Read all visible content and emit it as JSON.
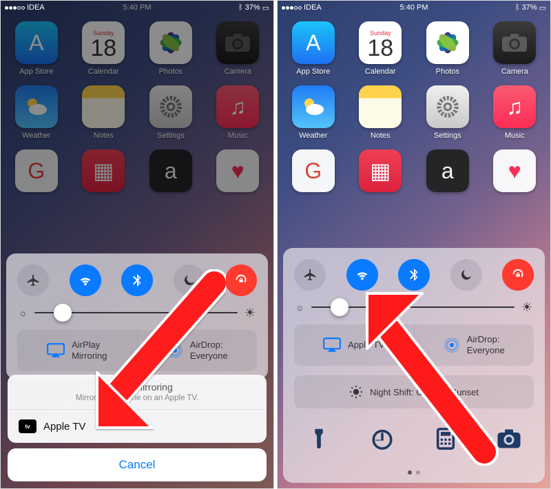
{
  "status": {
    "carrier": "IDEA",
    "time": "5:40 PM",
    "battery": "37%",
    "signal_dots": 3
  },
  "calendar": {
    "dow": "Sunday",
    "day": "18"
  },
  "apps": {
    "appstore": "App Store",
    "calendar": "Calendar",
    "photos": "Photos",
    "camera": "Camera",
    "weather": "Weather",
    "notes": "Notes",
    "settings": "Settings",
    "music": "Music"
  },
  "cc": {
    "airplay_mirroring": "AirPlay\nMirroring",
    "apple_tv": "Apple TV",
    "airdrop_label": "AirDrop:",
    "airdrop_value": "Everyone",
    "nightshift_prefix": "Night Shift:",
    "nightshift_value": "Off Until Sunset",
    "slider_pct_left": 14,
    "slider_pct_right": 14
  },
  "modal": {
    "title": "AirPlay Mirroring",
    "sub": "Mirror your iPhone on an Apple TV.",
    "device": "Apple TV",
    "cancel": "Cancel"
  }
}
